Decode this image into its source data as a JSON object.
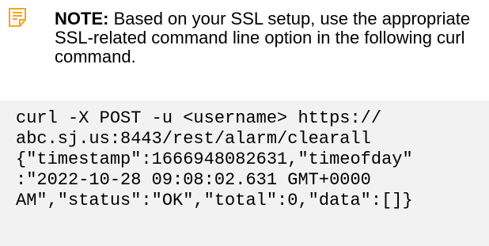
{
  "note": {
    "icon": "note-icon",
    "icon_color": "#f5a623",
    "label": "NOTE:",
    "text": " Based on your SSL setup, use the appropriate SSL-related command line option in the following curl command."
  },
  "code_block": {
    "background": "#f2f2f2",
    "lines": [
      "curl -X POST -u <username> https://",
      "abc.sj.us:8443/rest/alarm/clearall",
      "{\"timestamp\":1666948082631,\"timeofday\"",
      ":\"2022-10-28 09:08:02.631 GMT+0000",
      "AM\",\"status\":\"OK\",\"total\":0,\"data\":[]}"
    ]
  }
}
